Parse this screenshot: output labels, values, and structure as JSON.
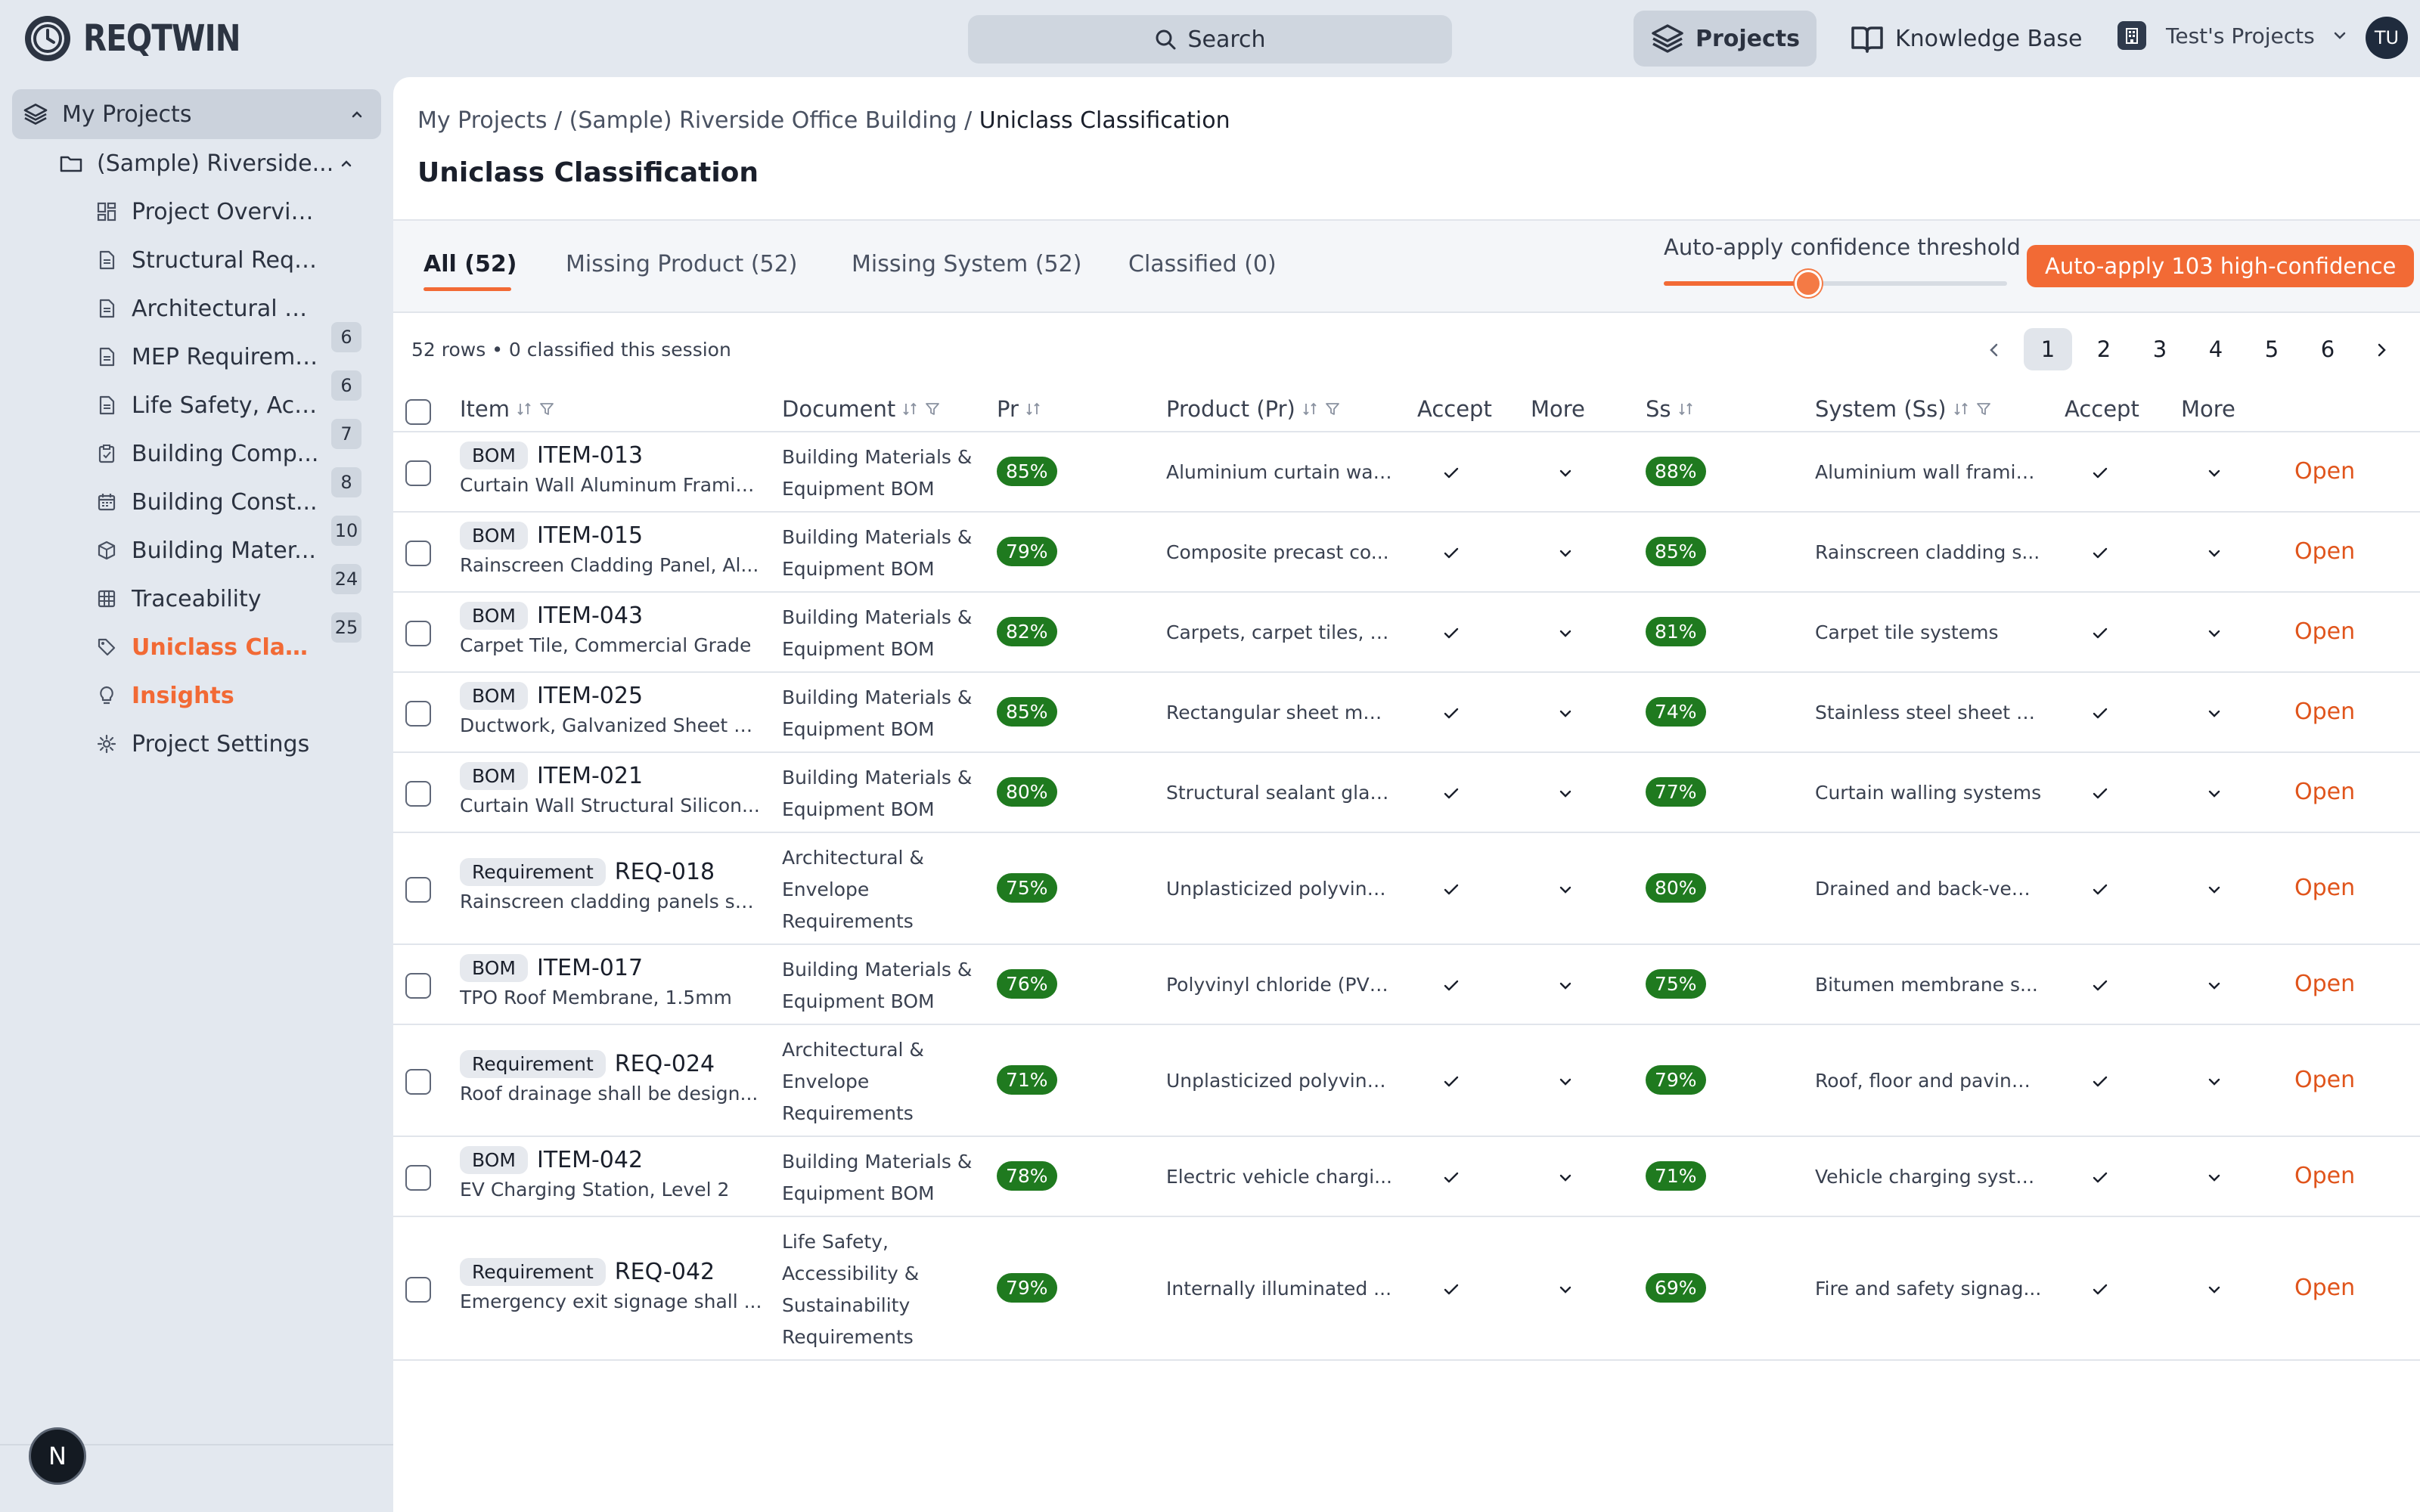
{
  "app": {
    "brand": "REQTWIN",
    "search_label": "Search",
    "nav_projects": "Projects",
    "nav_knowledge_base": "Knowledge Base",
    "workspace": "Test's Projects",
    "avatar_initials": "TU",
    "bottom_badge": "N"
  },
  "sidebar": {
    "root": "My Projects",
    "project": "(Sample) Riverside...",
    "items": [
      {
        "label": "Project Overview",
        "icon": "grid-icon",
        "count": ""
      },
      {
        "label": "Structural Requ...",
        "icon": "document-icon",
        "count": "6"
      },
      {
        "label": "Architectural & ...",
        "icon": "document-icon",
        "count": "6"
      },
      {
        "label": "MEP Requireme...",
        "icon": "document-icon",
        "count": "7"
      },
      {
        "label": "Life Safety, Acc...",
        "icon": "document-icon",
        "count": "8"
      },
      {
        "label": "Building Comp...",
        "icon": "clipboard-icon",
        "count": "10"
      },
      {
        "label": "Building Const...",
        "icon": "calendar-icon",
        "count": "24"
      },
      {
        "label": "Building Mater...",
        "icon": "box-icon",
        "count": "25"
      },
      {
        "label": "Traceability",
        "icon": "table-icon",
        "count": ""
      },
      {
        "label": "Uniclass Classific...",
        "icon": "tag-icon",
        "count": ""
      },
      {
        "label": "Insights",
        "icon": "lightbulb-icon",
        "count": ""
      },
      {
        "label": "Project Settings",
        "icon": "gear-icon",
        "count": ""
      }
    ]
  },
  "breadcrumb": {
    "part1": "My Projects",
    "sep": " / ",
    "part2": "(Sample) Riverside Office Building",
    "current": "Uniclass Classification"
  },
  "page_title": "Uniclass Classification",
  "tabs": [
    "All (52)",
    "Missing Product (52)",
    "Missing System (52)",
    "Classified (0)"
  ],
  "threshold": {
    "label": "Auto-apply confidence threshold",
    "value_fraction": 0.42,
    "button": "Auto-apply 103 high-confidence"
  },
  "rows_info": "52 rows • 0 classified this session",
  "pagination": [
    "1",
    "2",
    "3",
    "4",
    "5",
    "6"
  ],
  "columns": {
    "item": "Item",
    "document": "Document",
    "pr": "Pr",
    "product": "Product (Pr)",
    "accept1": "Accept",
    "more1": "More",
    "ss": "Ss",
    "system": "System (Ss)",
    "accept2": "Accept",
    "more2": "More"
  },
  "open_label": "Open",
  "colors": {
    "accent": "#f26a35",
    "confidence_badge": "#1f7a1f"
  },
  "rows": [
    {
      "type": "BOM",
      "id": "ITEM-013",
      "desc": "Curtain Wall Aluminum Framin...",
      "doc": [
        "Building Materials &",
        "Equipment BOM"
      ],
      "pr": "85%",
      "product": "Aluminium curtain wal...",
      "ss": "88%",
      "system": "Aluminium wall framin..."
    },
    {
      "type": "BOM",
      "id": "ITEM-015",
      "desc": "Rainscreen Cladding Panel, Al...",
      "doc": [
        "Building Materials &",
        "Equipment BOM"
      ],
      "pr": "79%",
      "product": "Composite precast co...",
      "ss": "85%",
      "system": "Rainscreen cladding s..."
    },
    {
      "type": "BOM",
      "id": "ITEM-043",
      "desc": "Carpet Tile, Commercial Grade",
      "doc": [
        "Building Materials &",
        "Equipment BOM"
      ],
      "pr": "82%",
      "product": "Carpets, carpet tiles, c...",
      "ss": "81%",
      "system": "Carpet tile systems"
    },
    {
      "type": "BOM",
      "id": "ITEM-025",
      "desc": "Ductwork, Galvanized Sheet M...",
      "doc": [
        "Building Materials &",
        "Equipment BOM"
      ],
      "pr": "85%",
      "product": "Rectangular sheet met...",
      "ss": "74%",
      "system": "Stainless steel sheet d..."
    },
    {
      "type": "BOM",
      "id": "ITEM-021",
      "desc": "Curtain Wall Structural Silicon...",
      "doc": [
        "Building Materials &",
        "Equipment BOM"
      ],
      "pr": "80%",
      "product": "Structural sealant glaz...",
      "ss": "77%",
      "system": "Curtain walling systems"
    },
    {
      "type": "Requirement",
      "id": "REQ-018",
      "desc": "Rainscreen cladding panels sh...",
      "doc": [
        "Architectural &",
        "Envelope",
        "Requirements"
      ],
      "pr": "75%",
      "product": "Unplasticized polyviny...",
      "ss": "80%",
      "system": "Drained and back-vent..."
    },
    {
      "type": "BOM",
      "id": "ITEM-017",
      "desc": "TPO Roof Membrane, 1.5mm",
      "doc": [
        "Building Materials &",
        "Equipment BOM"
      ],
      "pr": "76%",
      "product": "Polyvinyl chloride (PVC...",
      "ss": "75%",
      "system": "Bitumen membrane s..."
    },
    {
      "type": "Requirement",
      "id": "REQ-024",
      "desc": "Roof drainage shall be design...",
      "doc": [
        "Architectural &",
        "Envelope",
        "Requirements"
      ],
      "pr": "71%",
      "product": "Unplasticized polyviny...",
      "ss": "79%",
      "system": "Roof, floor and paving ..."
    },
    {
      "type": "BOM",
      "id": "ITEM-042",
      "desc": "EV Charging Station, Level 2",
      "doc": [
        "Building Materials &",
        "Equipment BOM"
      ],
      "pr": "78%",
      "product": "Electric vehicle chargi...",
      "ss": "71%",
      "system": "Vehicle charging syste..."
    },
    {
      "type": "Requirement",
      "id": "REQ-042",
      "desc": "Emergency exit signage shall ...",
      "doc": [
        "Life Safety,",
        "Accessibility &",
        "Sustainability",
        "Requirements"
      ],
      "pr": "79%",
      "product": "Internally illuminated ...",
      "ss": "69%",
      "system": "Fire and safety signag..."
    }
  ]
}
